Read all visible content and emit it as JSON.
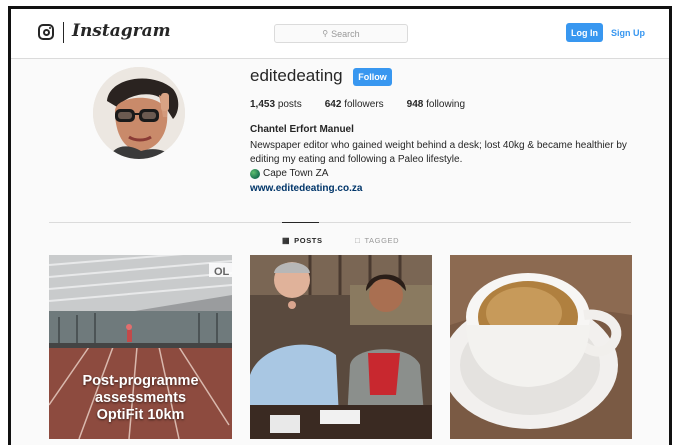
{
  "header": {
    "brand": "Instagram",
    "search_placeholder": "Search",
    "login_label": "Log In",
    "signup_label": "Sign Up"
  },
  "profile": {
    "username": "editedeating",
    "follow_label": "Follow",
    "stats": {
      "posts_count": "1,453",
      "posts_label": "posts",
      "followers_count": "642",
      "followers_label": "followers",
      "following_count": "948",
      "following_label": "following"
    },
    "full_name": "Chantel Erfort Manuel",
    "bio": "Newspaper editor who gained weight behind a desk; lost 40kg & became healthier by editing my eating and following a Paleo lifestyle.",
    "location": "Cape Town ZA",
    "website": "www.editedeating.co.za"
  },
  "tabs": [
    {
      "label": "POSTS",
      "icon": "grid-icon",
      "active": true
    },
    {
      "label": "TAGGED",
      "icon": "tag-icon",
      "active": false
    }
  ],
  "posts": [
    {
      "caption": "Post-programme assessments OptiFit 10km",
      "badge": "OL"
    },
    {
      "caption": ""
    },
    {
      "caption": ""
    }
  ],
  "colors": {
    "accent": "#3897f0",
    "link": "#003569",
    "border": "#dbdbdb",
    "text": "#262626"
  }
}
